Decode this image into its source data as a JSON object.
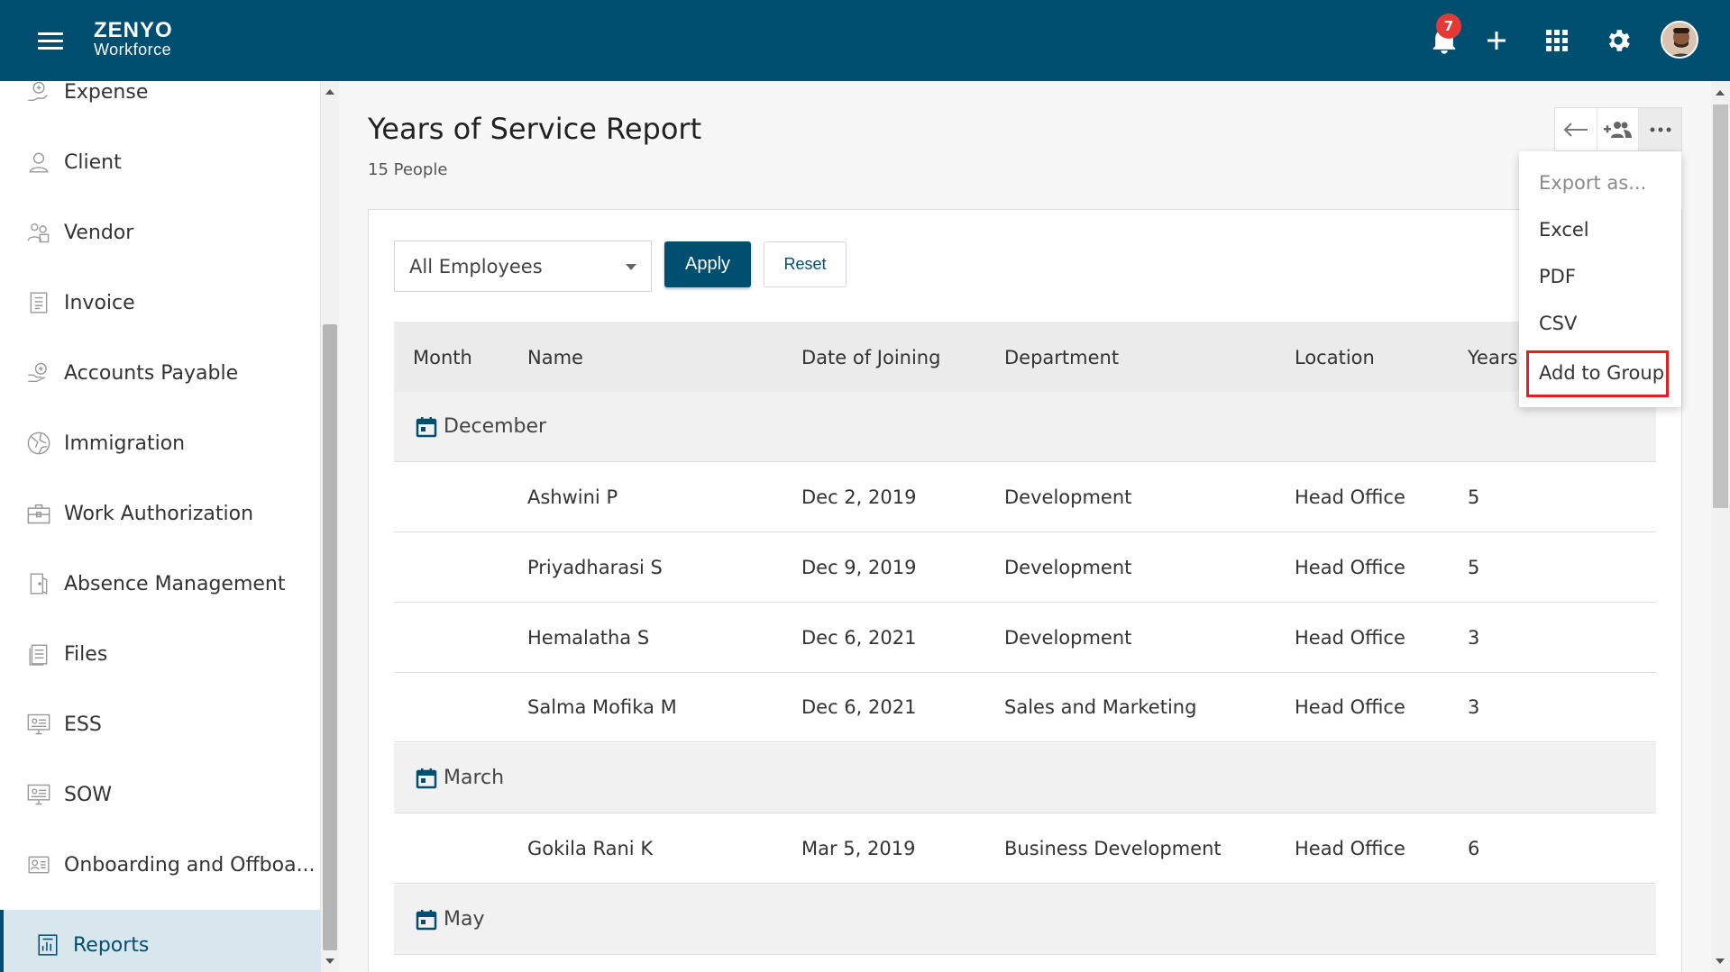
{
  "topbar": {
    "logo_line1": "ZENYO",
    "logo_line2": "Workforce",
    "notification_count": "7",
    "background_color": "#004f71"
  },
  "sidebar": {
    "items": [
      {
        "label": "Expense",
        "icon": "expense-icon"
      },
      {
        "label": "Client",
        "icon": "client-icon"
      },
      {
        "label": "Vendor",
        "icon": "vendor-icon"
      },
      {
        "label": "Invoice",
        "icon": "invoice-icon"
      },
      {
        "label": "Accounts Payable",
        "icon": "accounts-payable-icon"
      },
      {
        "label": "Immigration",
        "icon": "immigration-icon"
      },
      {
        "label": "Work Authorization",
        "icon": "work-authorization-icon"
      },
      {
        "label": "Absence Management",
        "icon": "absence-management-icon"
      },
      {
        "label": "Files",
        "icon": "files-icon"
      },
      {
        "label": "ESS",
        "icon": "ess-icon"
      },
      {
        "label": "SOW",
        "icon": "sow-icon"
      },
      {
        "label": "Onboarding and Offboa...",
        "icon": "onboarding-icon"
      },
      {
        "label": "Reports",
        "icon": "reports-icon",
        "active": true
      }
    ]
  },
  "page": {
    "title": "Years of Service Report",
    "subtitle": "15 People"
  },
  "filters": {
    "employee_filter_value": "All Employees",
    "apply_label": "Apply",
    "reset_label": "Reset"
  },
  "table": {
    "columns": [
      "Month",
      "Name",
      "Date of Joining",
      "Department",
      "Location",
      "Years"
    ],
    "groups": [
      {
        "month": "December",
        "rows": [
          {
            "name": "Ashwini P",
            "doj": "Dec 2, 2019",
            "department": "Development",
            "location": "Head Office",
            "years": "5"
          },
          {
            "name": "Priyadharasi S",
            "doj": "Dec 9, 2019",
            "department": "Development",
            "location": "Head Office",
            "years": "5"
          },
          {
            "name": "Hemalatha S",
            "doj": "Dec 6, 2021",
            "department": "Development",
            "location": "Head Office",
            "years": "3"
          },
          {
            "name": "Salma Mofika M",
            "doj": "Dec 6, 2021",
            "department": "Sales and Marketing",
            "location": "Head Office",
            "years": "3"
          }
        ]
      },
      {
        "month": "March",
        "rows": [
          {
            "name": "Gokila Rani K",
            "doj": "Mar 5, 2019",
            "department": "Business Development",
            "location": "Head Office",
            "years": "6"
          }
        ]
      },
      {
        "month": "May",
        "rows": []
      }
    ]
  },
  "export_menu": {
    "header": "Export as...",
    "items": [
      "Excel",
      "PDF",
      "CSV",
      "Add to Group"
    ],
    "highlighted": "Add to Group"
  }
}
